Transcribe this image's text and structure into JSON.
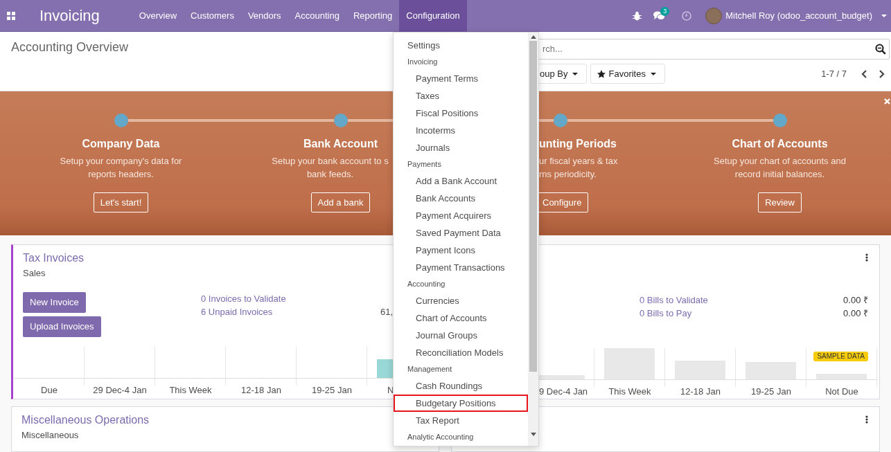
{
  "navbar": {
    "app_name": "Invoicing",
    "menu": [
      {
        "label": "Overview",
        "selected": false
      },
      {
        "label": "Customers",
        "selected": false
      },
      {
        "label": "Vendors",
        "selected": false
      },
      {
        "label": "Accounting",
        "selected": false
      },
      {
        "label": "Reporting",
        "selected": false
      },
      {
        "label": "Configuration",
        "selected": true
      }
    ],
    "messages_badge": "3",
    "user_name": "Mitchell Roy (odoo_account_budget)"
  },
  "control_panel": {
    "title": "Accounting Overview",
    "search": {
      "placeholder": "rch..."
    },
    "group_by_button": "oup By",
    "favorites_button": "Favorites",
    "pager": "1-7 / 7"
  },
  "onboarding": {
    "steps": [
      {
        "title": "Company Data",
        "description_lines": [
          "Setup your company's data for",
          "reports headers."
        ],
        "button": "Let's start!"
      },
      {
        "title": "Bank Account",
        "description_lines": [
          "Setup your bank account to s",
          "bank feeds."
        ],
        "button": "Add a bank"
      },
      {
        "title": "unting Periods",
        "description_lines": [
          "ur fiscal years & tax",
          "rns periodicity."
        ],
        "button": "Configure"
      },
      {
        "title": "Chart of Accounts",
        "description_lines": [
          "Setup your chart of accounts and",
          "record initial balances."
        ],
        "button": "Review"
      }
    ]
  },
  "dashboard": {
    "journals": [
      {
        "title": "Tax Invoices",
        "subtitle": "Sales",
        "highlighted": true,
        "menu_icon": false,
        "buttons": [
          "New Invoice",
          "Upload Invoices"
        ],
        "stats": [
          {
            "label": "0 Invoices to Validate"
          },
          {
            "label": "6 Unpaid Invoices",
            "amount": "61,"
          }
        ],
        "chart_labels": [
          "Due",
          "29 Dec-4 Jan",
          "This Week",
          "12-18 Jan",
          "19-25 Jan",
          "N"
        ]
      },
      {
        "highlighted": false,
        "menu_icon": true,
        "stats": [
          {
            "label": "0 Bills to Validate",
            "amount": "0.00 ₹"
          },
          {
            "label": "0 Bills to Pay",
            "amount": "0.00 ₹"
          }
        ],
        "chart_labels": [
          "9 Dec-4 Jan",
          "This Week",
          "12-18 Jan",
          "19-25 Jan",
          "Not Due"
        ],
        "sample_badge": "SAMPLE DATA"
      },
      {
        "title": "Miscellaneous Operations",
        "subtitle": "Miscellaneous",
        "highlighted": false,
        "menu_icon": false
      },
      {
        "highlighted": false,
        "menu_icon": true
      }
    ]
  },
  "configuration_menu": {
    "items": [
      {
        "kind": "top",
        "label": "Settings",
        "highlighted": false
      },
      {
        "kind": "header",
        "label": "Invoicing",
        "highlighted": false
      },
      {
        "kind": "item",
        "label": "Payment Terms",
        "highlighted": false
      },
      {
        "kind": "item",
        "label": "Taxes",
        "highlighted": false
      },
      {
        "kind": "item",
        "label": "Fiscal Positions",
        "highlighted": false
      },
      {
        "kind": "item",
        "label": "Incoterms",
        "highlighted": false
      },
      {
        "kind": "item",
        "label": "Journals",
        "highlighted": false
      },
      {
        "kind": "header",
        "label": "Payments",
        "highlighted": false
      },
      {
        "kind": "item",
        "label": "Add a Bank Account",
        "highlighted": false
      },
      {
        "kind": "item",
        "label": "Bank Accounts",
        "highlighted": false
      },
      {
        "kind": "item",
        "label": "Payment Acquirers",
        "highlighted": false
      },
      {
        "kind": "item",
        "label": "Saved Payment Data",
        "highlighted": false
      },
      {
        "kind": "item",
        "label": "Payment Icons",
        "highlighted": false
      },
      {
        "kind": "item",
        "label": "Payment Transactions",
        "highlighted": false
      },
      {
        "kind": "header",
        "label": "Accounting",
        "highlighted": false
      },
      {
        "kind": "item",
        "label": "Currencies",
        "highlighted": false
      },
      {
        "kind": "item",
        "label": "Chart of Accounts",
        "highlighted": false
      },
      {
        "kind": "item",
        "label": "Journal Groups",
        "highlighted": false
      },
      {
        "kind": "item",
        "label": "Reconciliation Models",
        "highlighted": false
      },
      {
        "kind": "header",
        "label": "Management",
        "highlighted": false
      },
      {
        "kind": "item",
        "label": "Cash Roundings",
        "highlighted": false
      },
      {
        "kind": "item",
        "label": "Budgetary Positions",
        "highlighted": true
      },
      {
        "kind": "item",
        "label": "Tax Report",
        "highlighted": false
      },
      {
        "kind": "header",
        "label": "Analytic Accounting",
        "highlighted": false
      }
    ]
  }
}
